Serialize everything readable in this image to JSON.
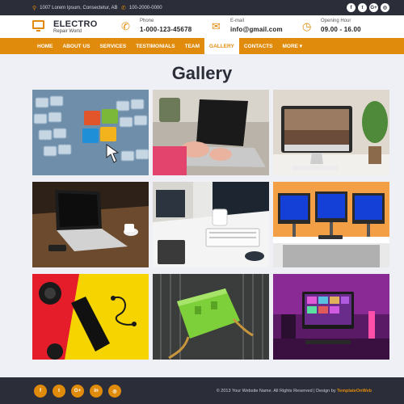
{
  "topbar": {
    "address": "1007 Lorem Ipsum, Consectetur, AB",
    "phone": "100-2000-0000",
    "social": [
      {
        "icon": "facebook-icon",
        "glyph": "f"
      },
      {
        "icon": "twitter-icon",
        "glyph": "t"
      },
      {
        "icon": "google-plus-icon",
        "glyph": "G+"
      },
      {
        "icon": "instagram-icon",
        "glyph": "◎"
      }
    ]
  },
  "header": {
    "brand": "ELECTRO",
    "brand_sub": "Repair World",
    "phone_label": "Phone",
    "phone_value": "1-000-123-45678",
    "email_label": "E-mail",
    "email_value": "info@gmail.com",
    "hours_label": "Opening Hour",
    "hours_value": "09.00 - 16.00"
  },
  "nav": {
    "items": [
      "HOME",
      "ABOUT US",
      "SERVICES",
      "TESTIMONIALS",
      "TEAM",
      "GALLERY",
      "CONTACTS",
      "MORE ▾"
    ],
    "active_index": 5
  },
  "gallery": {
    "title": "Gallery",
    "images": [
      {
        "name": "windows-keyboard-image"
      },
      {
        "name": "laptop-typing-image"
      },
      {
        "name": "imac-desk-image"
      },
      {
        "name": "laptop-wooden-desk-image"
      },
      {
        "name": "office-desk-image"
      },
      {
        "name": "triple-monitor-image"
      },
      {
        "name": "phone-earbuds-image"
      },
      {
        "name": "power-socket-image"
      },
      {
        "name": "neon-setup-image"
      }
    ]
  },
  "footer": {
    "social": [
      "f",
      "t",
      "G+",
      "in",
      "◎"
    ],
    "copyright": "© 2013 Your Website Name. All Rights Reserved | Design by",
    "designer": "TemplateOnWeb"
  },
  "colors": {
    "accent": "#e08b0b",
    "dark": "#2b2e39",
    "background": "#eef0f6"
  }
}
